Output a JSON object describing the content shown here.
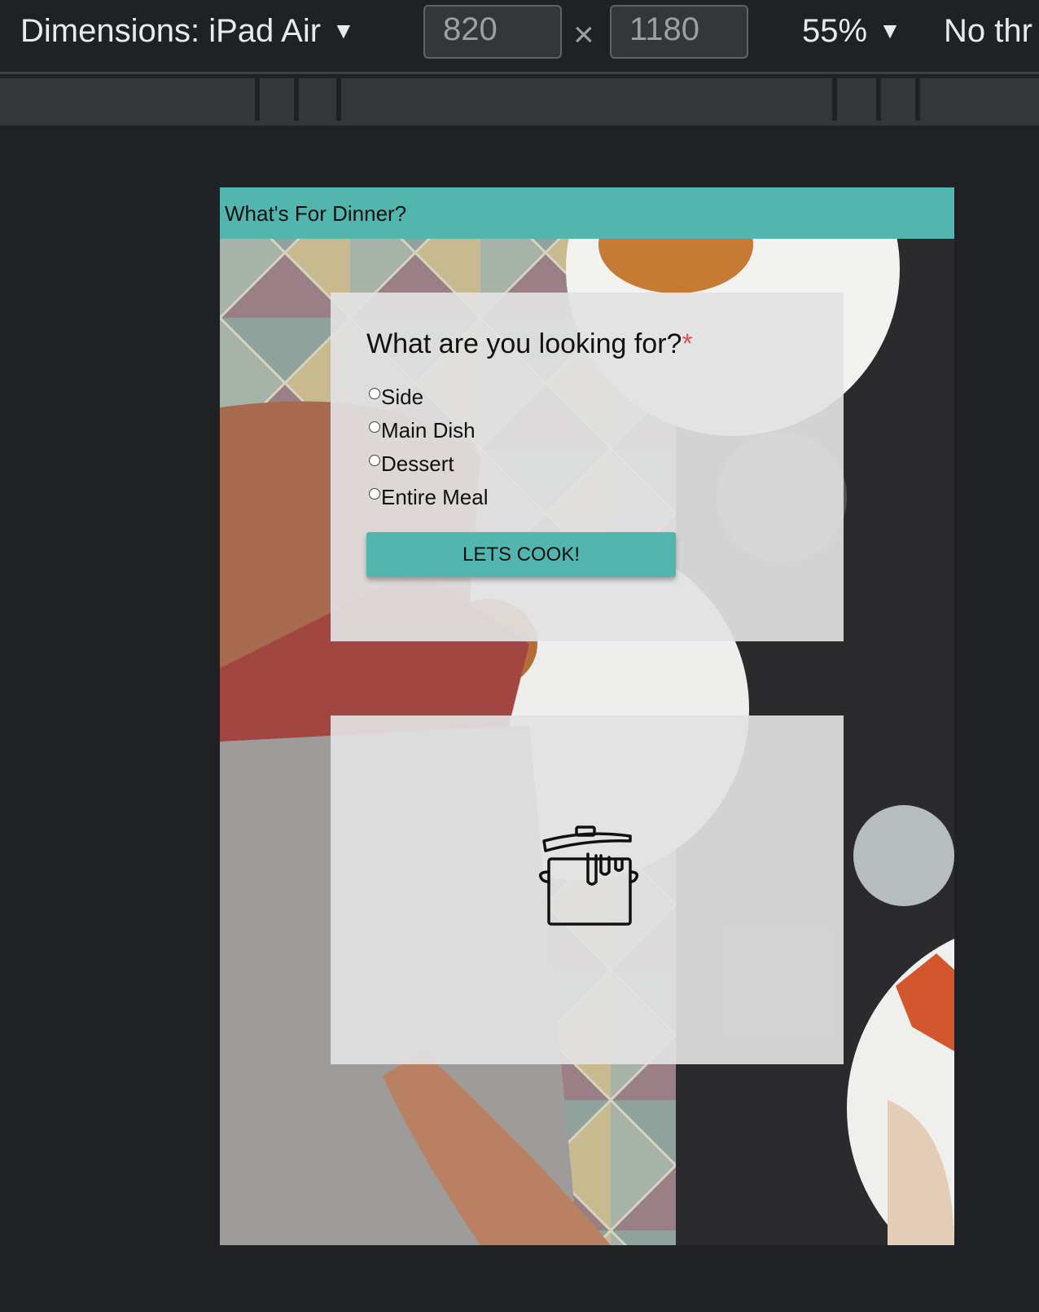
{
  "devtools": {
    "dimensions_label": "Dimensions: iPad Air",
    "width_value": "820",
    "height_value": "1180",
    "times_symbol": "×",
    "zoom": "55%",
    "throttle": "No thr"
  },
  "page": {
    "nav_title": "What's For Dinner?",
    "form": {
      "question": "What are you looking for?",
      "required_marker": "*",
      "options": [
        "Side",
        "Main Dish",
        "Dessert",
        "Entire Meal"
      ],
      "submit_label": "LETS COOK!"
    },
    "result": {
      "icon": "cooking-pot-icon"
    }
  },
  "colors": {
    "accent": "#53b6ae",
    "required": "#e05252",
    "devtools_bg": "#202124",
    "card_bg": "#e2e2e2"
  }
}
